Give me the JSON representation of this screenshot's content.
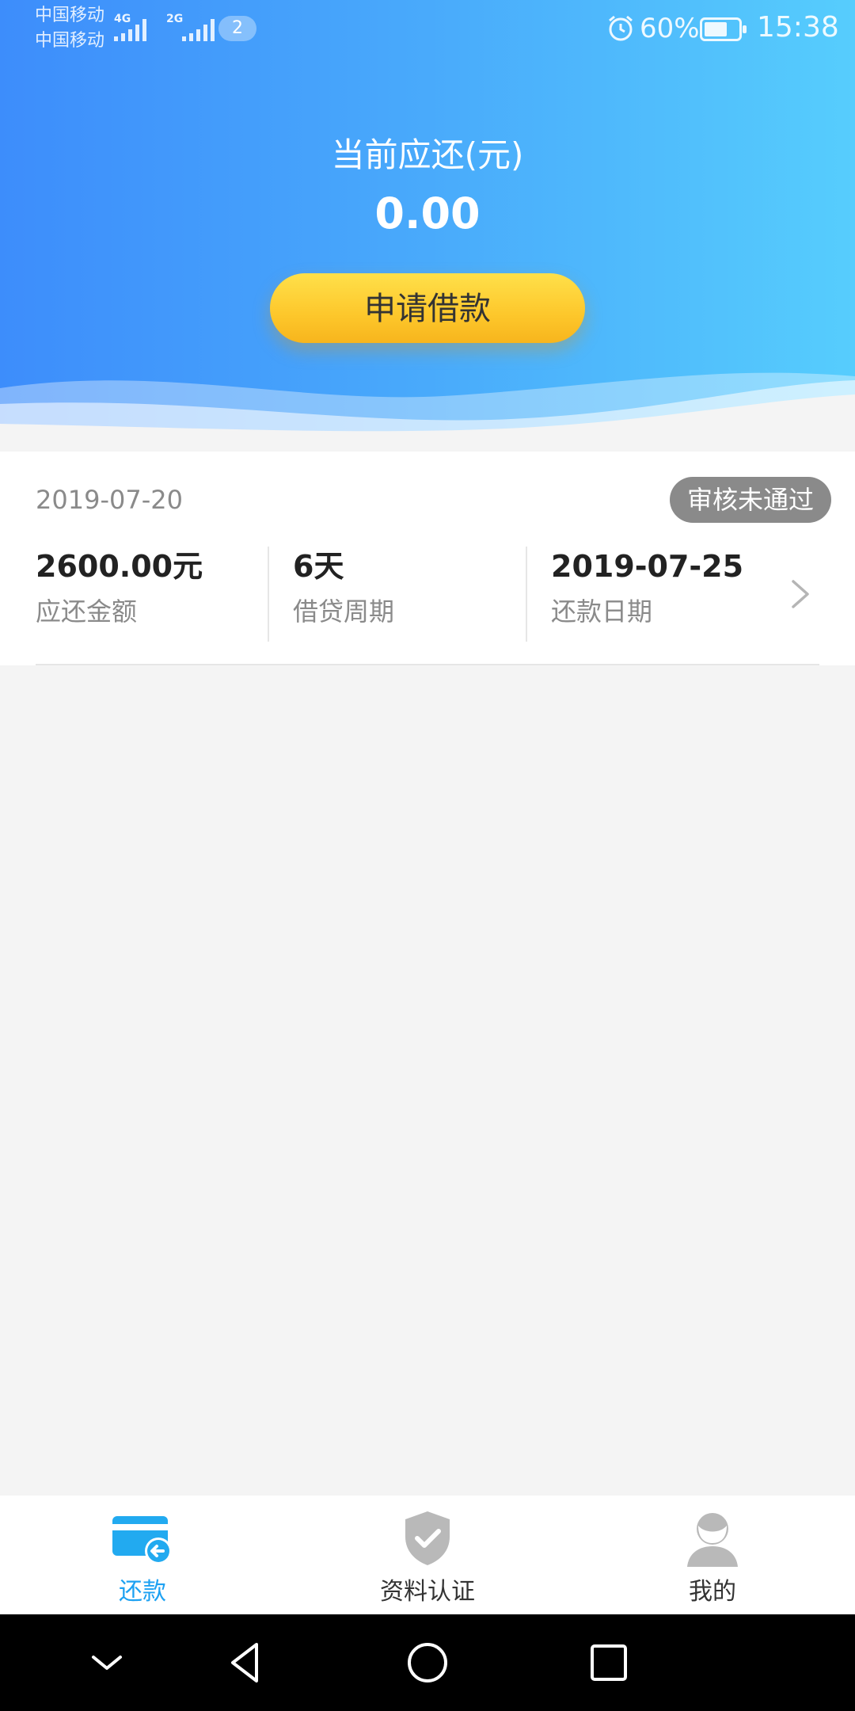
{
  "status_bar": {
    "carrier_1": "中国移动",
    "carrier_2": "中国移动",
    "net_1": "4G",
    "net_2": "2G",
    "sim_badge": "2",
    "battery": "60%",
    "time": "15:38"
  },
  "header": {
    "due_label": "当前应还(元)",
    "due_amount": "0.00",
    "apply_button": "申请借款"
  },
  "loan_card": {
    "date": "2019-07-20",
    "status": "审核未通过",
    "stats": [
      {
        "value": "2600.00元",
        "label": "应还金额"
      },
      {
        "value": "6天",
        "label": "借贷周期"
      },
      {
        "value": "2019-07-25",
        "label": "还款日期"
      }
    ]
  },
  "tabs": [
    {
      "label": "还款",
      "icon": "repay-card-icon",
      "active": true
    },
    {
      "label": "资料认证",
      "icon": "shield-check-icon",
      "active": false
    },
    {
      "label": "我的",
      "icon": "user-avatar-icon",
      "active": false
    }
  ],
  "colors": {
    "header_start": "#3d8dfb",
    "header_end": "#56cdfd",
    "button_yellow": "#fdc72b",
    "active_tab": "#1da1f2",
    "badge_gray": "#8a8a8a"
  }
}
